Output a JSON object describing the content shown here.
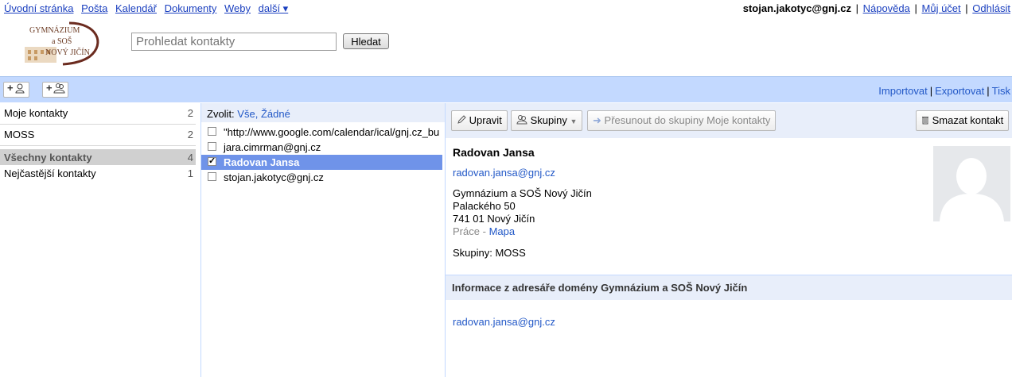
{
  "topnav": {
    "links": [
      "Úvodní stránka",
      "Pošta",
      "Kalendář",
      "Dokumenty",
      "Weby"
    ],
    "more": "další ▾"
  },
  "account": {
    "email": "stojan.jakotyc@gnj.cz",
    "help": "Nápověda",
    "my_account": "Můj účet",
    "logout": "Odhlásit"
  },
  "logo": {
    "line1": "GYMNÁZIUM",
    "line2": "a SOŠ",
    "line3": "NOVÝ JIČÍN"
  },
  "search": {
    "placeholder": "Prohledat kontakty",
    "button": "Hledat"
  },
  "actions": {
    "add_contact_icon": "add-contact-icon",
    "add_group_icon": "add-group-icon",
    "import": "Importovat",
    "export": "Exportovat",
    "print": "Tisk"
  },
  "groups": [
    {
      "name": "Moje kontakty",
      "count": "2"
    },
    {
      "name": "MOSS",
      "count": "2"
    },
    {
      "name": "Všechny kontakty",
      "count": "4"
    },
    {
      "name": "Nejčastější kontakty",
      "count": "1"
    }
  ],
  "list": {
    "select_label": "Zvolit:",
    "select_all": "Vše",
    "select_none": "Žádné",
    "contacts": [
      {
        "label": "\"http://www.google.com/calendar/ical/gnj.cz_bu",
        "checked": false
      },
      {
        "label": "jara.cimrman@gnj.cz",
        "checked": false
      },
      {
        "label": "Radovan Jansa",
        "checked": true
      },
      {
        "label": "stojan.jakotyc@gnj.cz",
        "checked": false
      }
    ]
  },
  "detail": {
    "edit": "Upravit",
    "groups_btn": "Skupiny",
    "move": "Přesunout do skupiny Moje kontakty",
    "delete": "Smazat kontakt",
    "name": "Radovan Jansa",
    "email": "radovan.jansa@gnj.cz",
    "org": "Gymnázium a SOŠ Nový Jičín",
    "street": "Palackého 50",
    "city": "741 01 Nový Jičín",
    "addr_type": "Práce",
    "map_link": "Mapa",
    "groups_text": "Skupiny: MOSS",
    "directory_title": "Informace z adresáře domény Gymnázium a SOŠ Nový Jičín",
    "directory_email": "radovan.jansa@gnj.cz"
  }
}
